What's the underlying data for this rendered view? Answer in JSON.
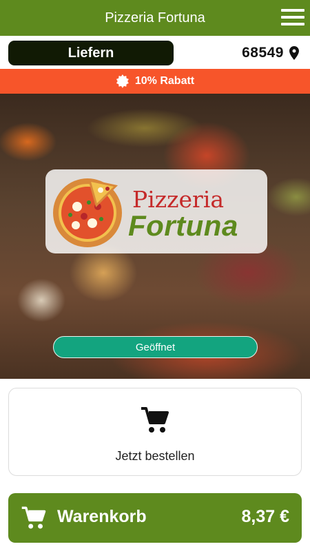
{
  "header": {
    "title": "Pizzeria Fortuna",
    "menu_icon": "hamburger-menu-icon",
    "color": "#5e8a1e"
  },
  "delivery": {
    "mode_label": "Liefern",
    "zip": "68549",
    "location_icon": "location-pin-icon"
  },
  "promo": {
    "text": "10% Rabatt",
    "icon": "discount-badge-icon",
    "color": "#f7552a"
  },
  "hero": {
    "logo_text_top": "Pizzeria",
    "logo_text_bottom": "Fortuna",
    "status": "Geöffnet",
    "status_color": "#13a47f"
  },
  "order": {
    "label": "Jetzt bestellen",
    "icon": "shopping-cart-icon"
  },
  "cart": {
    "label": "Warenkorb",
    "total": "8,37 €",
    "icon": "shopping-cart-icon"
  }
}
